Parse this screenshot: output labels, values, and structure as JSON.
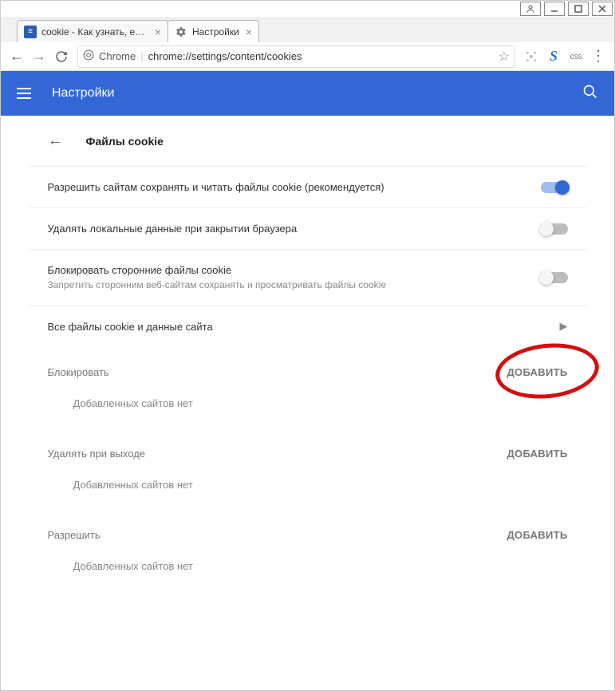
{
  "window_controls": {
    "icons": [
      "user",
      "min",
      "max",
      "close"
    ]
  },
  "tabs": [
    {
      "title": "cookie - Как узнать, есть",
      "favicon": "stack"
    },
    {
      "title": "Настройки",
      "favicon": "gear"
    }
  ],
  "address_bar": {
    "label": "Chrome",
    "url": "chrome://settings/content/cookies"
  },
  "header": {
    "title": "Настройки"
  },
  "page": {
    "section_title": "Файлы cookie",
    "rows": {
      "allow": {
        "label": "Разрешить сайтам сохранять и читать файлы cookie (рекомендуется)",
        "toggle": true
      },
      "delete_on_exit": {
        "label": "Удалять локальные данные при закрытии браузера",
        "toggle": false
      },
      "block_third": {
        "label": "Блокировать сторонние файлы cookie",
        "sub": "Запретить сторонним веб-сайтам сохранять и просматривать файлы cookie",
        "toggle": false
      },
      "all_data": {
        "label": "Все файлы cookie и данные сайта"
      }
    },
    "groups": [
      {
        "label": "Блокировать",
        "add": "ДОБАВИТЬ",
        "empty": "Добавленных сайтов нет"
      },
      {
        "label": "Удалять при выходе",
        "add": "ДОБАВИТЬ",
        "empty": "Добавленных сайтов нет"
      },
      {
        "label": "Разрешить",
        "add": "ДОБАВИТЬ",
        "empty": "Добавленных сайтов нет"
      }
    ]
  }
}
